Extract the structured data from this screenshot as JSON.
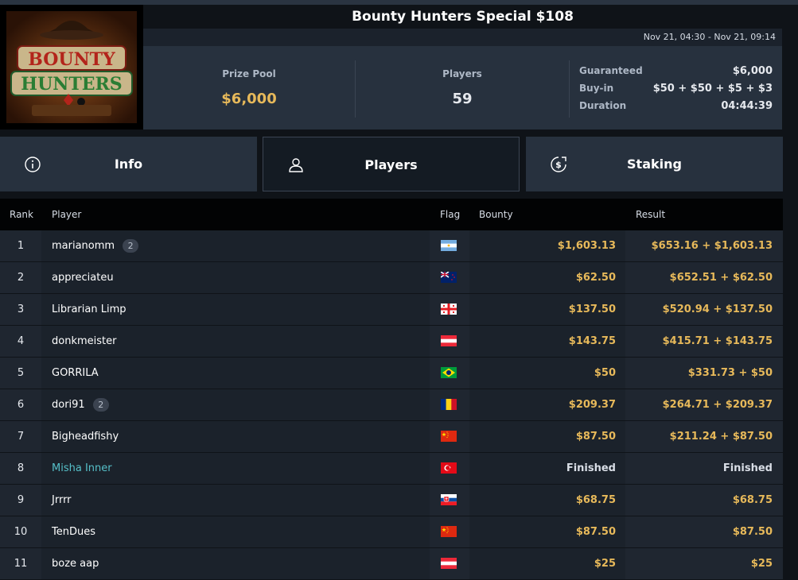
{
  "header": {
    "title": "Bounty Hunters Special $108",
    "time_range": "Nov 21, 04:30 - Nov 21, 09:14",
    "logo_text_line1": "BOUNTY",
    "logo_text_line2": "HUNTERS"
  },
  "stats": {
    "prize_pool_label": "Prize Pool",
    "prize_pool_value": "$6,000",
    "players_label": "Players",
    "players_value": "59",
    "guaranteed_label": "Guaranteed",
    "guaranteed_value": "$6,000",
    "buyin_label": "Buy-in",
    "buyin_value": "$50 + $50 + $5 + $3",
    "duration_label": "Duration",
    "duration_value": "04:44:39"
  },
  "tabs": [
    {
      "label": "Info",
      "icon": "info-icon"
    },
    {
      "label": "Players",
      "icon": "user-icon"
    },
    {
      "label": "Staking",
      "icon": "dollar-circle-icon"
    }
  ],
  "table": {
    "headers": {
      "rank": "Rank",
      "player": "Player",
      "flag": "Flag",
      "bounty": "Bounty",
      "result": "Result"
    },
    "rows": [
      {
        "rank": "1",
        "player": "marianomm",
        "badge": "2",
        "flag": "argentina",
        "bounty": "$1,603.13",
        "result": "$653.16 + $1,603.13"
      },
      {
        "rank": "2",
        "player": "appreciateu",
        "badge": "",
        "flag": "new-zealand",
        "bounty": "$62.50",
        "result": "$652.51 + $62.50"
      },
      {
        "rank": "3",
        "player": "Librarian Limp",
        "badge": "",
        "flag": "georgia",
        "bounty": "$137.50",
        "result": "$520.94 + $137.50"
      },
      {
        "rank": "4",
        "player": "donkmeister",
        "badge": "",
        "flag": "austria",
        "bounty": "$143.75",
        "result": "$415.71 + $143.75"
      },
      {
        "rank": "5",
        "player": "GORRILA",
        "badge": "",
        "flag": "brazil",
        "bounty": "$50",
        "result": "$331.73 + $50"
      },
      {
        "rank": "6",
        "player": "dori91",
        "badge": "2",
        "flag": "romania",
        "bounty": "$209.37",
        "result": "$264.71 + $209.37"
      },
      {
        "rank": "7",
        "player": "Bigheadfishy",
        "badge": "",
        "flag": "china",
        "bounty": "$87.50",
        "result": "$211.24 + $87.50"
      },
      {
        "rank": "8",
        "player": "Misha Inner",
        "badge": "",
        "flag": "turkey",
        "bounty": "Finished",
        "result": "Finished"
      },
      {
        "rank": "9",
        "player": "Jrrrr",
        "badge": "",
        "flag": "slovakia",
        "bounty": "$68.75",
        "result": "$68.75"
      },
      {
        "rank": "10",
        "player": "TenDues",
        "badge": "",
        "flag": "china",
        "bounty": "$87.50",
        "result": "$87.50"
      },
      {
        "rank": "11",
        "player": "boze aap",
        "badge": "",
        "flag": "austria",
        "bounty": "$25",
        "result": "$25"
      }
    ]
  },
  "colors": {
    "accent_gold": "#e7b95a",
    "link_teal": "#56c0c9",
    "panel": "#27313e",
    "background": "#0f1318"
  }
}
